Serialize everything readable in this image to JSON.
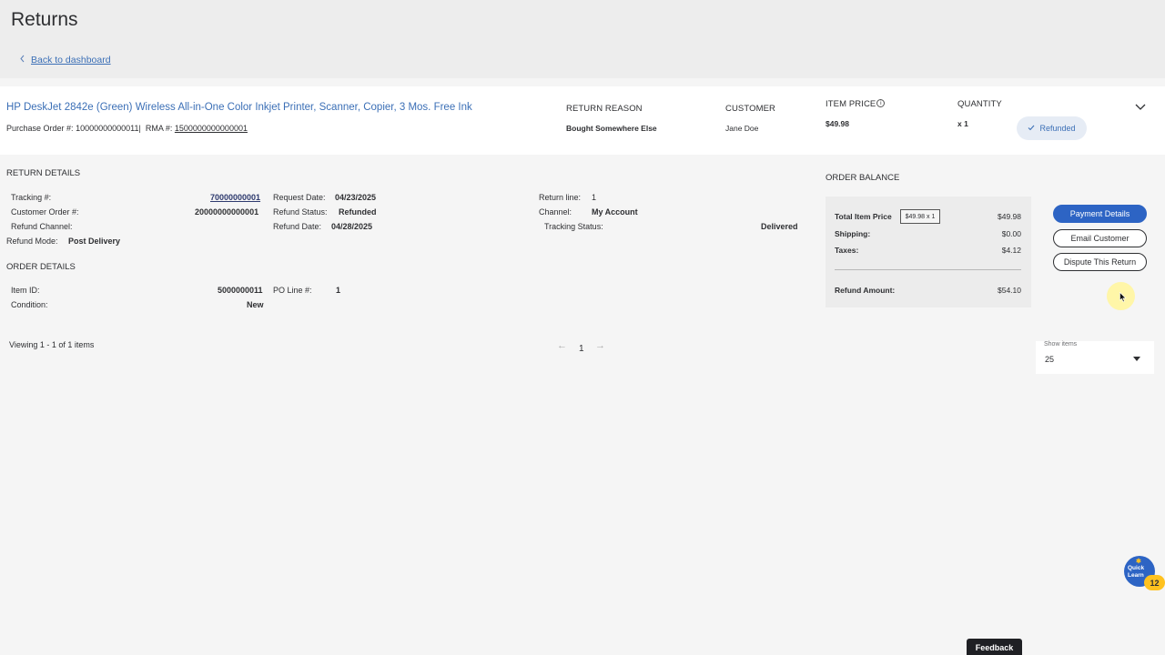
{
  "page": {
    "title": "Returns",
    "back_link": "Back to dashboard"
  },
  "item": {
    "title": "HP DeskJet 2842e (Green) Wireless All-in-One Color Inkjet Printer, Scanner, Copier, 3 Mos. Free Ink",
    "po_label": "Purchase Order #:",
    "po_value": "10000000000011",
    "separator": "|",
    "rma_label": "RMA #:",
    "rma_value": "1500000000000001",
    "return_reason_label": "RETURN REASON",
    "return_reason_value": "Bought Somewhere Else",
    "customer_label": "CUSTOMER",
    "customer_value": "Jane Doe",
    "item_price_label": "ITEM PRICE",
    "item_price_info": "i",
    "item_price_value": "$49.98",
    "quantity_label": "QUANTITY",
    "quantity_value": "x 1",
    "status": "Refunded",
    "status_icon": "check-icon",
    "expand_icon": "chevron-down-icon"
  },
  "return_details": {
    "heading": "RETURN DETAILS",
    "tracking_label": "Tracking #:",
    "tracking_value": "70000000001",
    "customer_order_label": "Customer Order #:",
    "customer_order_value": "20000000000001",
    "refund_channel_label": "Refund Channel:",
    "refund_mode_label": "Refund Mode:",
    "refund_mode_value": "Post Delivery",
    "request_date_label": "Request Date:",
    "request_date_value": "04/23/2025",
    "refund_status_label": "Refund Status:",
    "refund_status_value": "Refunded",
    "refund_date_label": "Refund Date:",
    "refund_date_value": "04/28/2025",
    "return_line_label": "Return line:",
    "return_line_value": "1",
    "channel_label": "Channel:",
    "channel_value": "My Account",
    "tracking_status_label": "Tracking Status:",
    "tracking_status_value": "Delivered"
  },
  "order_details": {
    "heading": "ORDER DETAILS",
    "item_id_label": "Item ID:",
    "item_id_value": "5000000011",
    "condition_label": "Condition:",
    "condition_value": "New",
    "po_line_label": "PO Line #:",
    "po_line_value": "1"
  },
  "order_balance": {
    "heading": "ORDER BALANCE",
    "total_item_price_label": "Total Item Price",
    "total_item_price_tag": "$49.98 x 1",
    "total_item_price_value": "$49.98",
    "shipping_label": "Shipping:",
    "shipping_value": "$0.00",
    "taxes_label": "Taxes:",
    "taxes_value": "$4.12",
    "refund_amount_label": "Refund Amount:",
    "refund_amount_value": "$54.10"
  },
  "actions": {
    "payment_details": "Payment Details",
    "email_customer": "Email Customer",
    "dispute_return": "Dispute This Return"
  },
  "pagination": {
    "viewing": "Viewing 1 - 1 of 1 items",
    "prev": "←",
    "page": "1",
    "next": "→",
    "show_items_label": "Show items",
    "show_items_value": "25"
  },
  "widgets": {
    "quick_learn": "Quick Learn",
    "quick_learn_badge": "12",
    "feedback": "Feedback"
  },
  "colors": {
    "accent": "#2d64c4",
    "link": "#3b6fb6",
    "badge": "#ffc220"
  }
}
